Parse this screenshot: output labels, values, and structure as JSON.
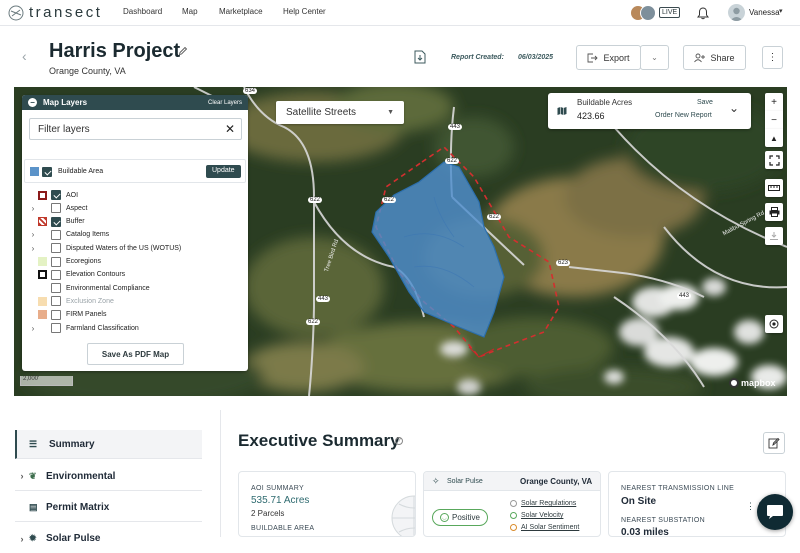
{
  "app": {
    "logo_text": "transect"
  },
  "nav": {
    "items": [
      "Dashboard",
      "Map",
      "Marketplace",
      "Help Center"
    ]
  },
  "user": {
    "live_label": "LIVE",
    "name": "Vanessa"
  },
  "project": {
    "title": "Harris Project",
    "subtitle": "Orange County, VA",
    "report_created_label": "Report Created:",
    "report_created_date": "06/03/2025",
    "export_label": "Export",
    "share_label": "Share"
  },
  "map": {
    "style_select": "Satellite Streets",
    "road_labels": [
      "634",
      "443",
      "622",
      "622",
      "622",
      "443",
      "623",
      "622",
      "622",
      "443",
      "622",
      "641"
    ],
    "scale_label": "2,000'",
    "attribution": "mapbox",
    "road_names": [
      "Tree Bird Rd",
      "Malibu Spring Rd"
    ]
  },
  "buildable": {
    "title": "Buildable Acres",
    "value": "423.66",
    "save_label": "Save",
    "order_label": "Order New Report"
  },
  "layers_panel": {
    "title": "Map Layers",
    "clear_label": "Clear Layers",
    "filter_placeholder": "Filter layers",
    "buildable_label": "Buildable Area",
    "update_label": "Update",
    "save_pdf_label": "Save As PDF Map",
    "items": [
      {
        "label": "AOI",
        "checked": true,
        "chev": false
      },
      {
        "label": "Aspect",
        "checked": false,
        "chev": true
      },
      {
        "label": "Buffer",
        "checked": true,
        "chev": false
      },
      {
        "label": "Catalog Items",
        "checked": false,
        "chev": true
      },
      {
        "label": "Disputed Waters of the US (WOTUS)",
        "checked": false,
        "chev": true
      },
      {
        "label": "Ecoregions",
        "checked": false,
        "chev": false
      },
      {
        "label": "Elevation Contours",
        "checked": false,
        "chev": false
      },
      {
        "label": "Environmental Compliance",
        "checked": false,
        "chev": false
      },
      {
        "label": "Exclusion Zone",
        "checked": false,
        "chev": false,
        "muted": true
      },
      {
        "label": "FIRM Panels",
        "checked": false,
        "chev": false
      },
      {
        "label": "Farmland Classification",
        "checked": false,
        "chev": true
      }
    ],
    "colors": {
      "buildable": "#5b93c9",
      "aoi": "#8b1a1a",
      "buffer": "#c0392b",
      "ecoregions": "#e4f2c4",
      "elevation": "#111111",
      "exclusion": "#f7ddb0",
      "firm": "#e8ad8a"
    }
  },
  "sidebar": {
    "items": [
      {
        "label": "Summary",
        "icon": "list-icon"
      },
      {
        "label": "Environmental",
        "icon": "leaf-icon"
      },
      {
        "label": "Permit Matrix",
        "icon": "clipboard-icon"
      },
      {
        "label": "Solar Pulse",
        "icon": "sun-icon"
      }
    ]
  },
  "summary": {
    "title": "Executive Summary",
    "aoi_cap": "AOI SUMMARY",
    "aoi_acres": "535.71 Acres",
    "parcels": "2 Parcels",
    "buildable_cap": "BUILDABLE AREA",
    "solar_title": "Solar Pulse",
    "solar_location": "Orange County, VA",
    "positive_label": "Positive",
    "solar_links": [
      "Solar Regulations",
      "Solar Velocity",
      "AI Solar Sentiment"
    ],
    "tx_cap": "NEAREST TRANSMISSION LINE",
    "tx_value": "On Site",
    "sub_cap": "NEAREST SUBSTATION",
    "sub_value": "0.03 miles"
  }
}
